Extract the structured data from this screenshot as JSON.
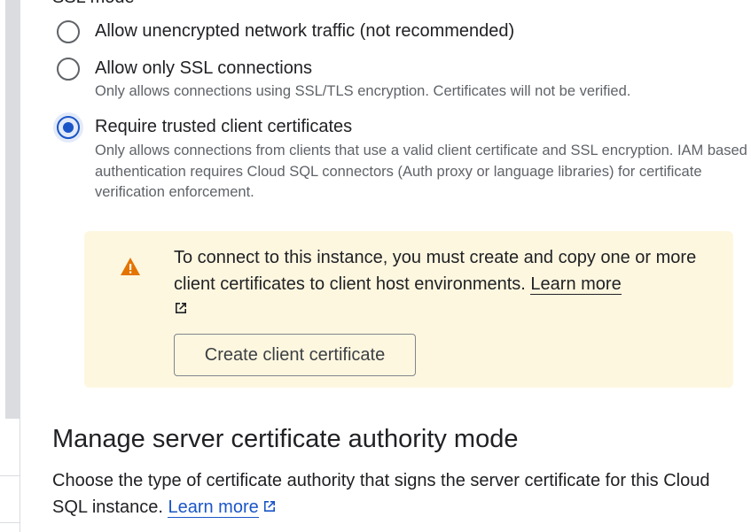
{
  "ssl_section": {
    "heading": "SSL mode",
    "options": [
      {
        "label": "Allow unencrypted network traffic (not recommended)",
        "description": "",
        "selected": false
      },
      {
        "label": "Allow only SSL connections",
        "description": "Only allows connections using SSL/TLS encryption. Certificates will not be verified.",
        "selected": false
      },
      {
        "label": "Require trusted client certificates",
        "description": "Only allows connections from clients that use a valid client certificate and SSL encryption. IAM based authentication requires Cloud SQL connectors (Auth proxy or language libraries) for certificate verification enforcement.",
        "selected": true
      }
    ]
  },
  "warning": {
    "icon": "warning-icon",
    "text": "To connect to this instance, you must create and copy one or more client certificates to client host environments.",
    "link_label": "Learn more",
    "link_icon": "external-link-icon",
    "button_label": "Create client certificate",
    "background_color": "#fef7e0",
    "icon_color": "#e37400"
  },
  "ca_section": {
    "title": "Manage server certificate authority mode",
    "description": "Choose the type of certificate authority that signs the server certificate for this Cloud SQL instance.",
    "link_label": "Learn more",
    "link_icon": "external-link-icon",
    "accent_color": "#1a56c7"
  }
}
